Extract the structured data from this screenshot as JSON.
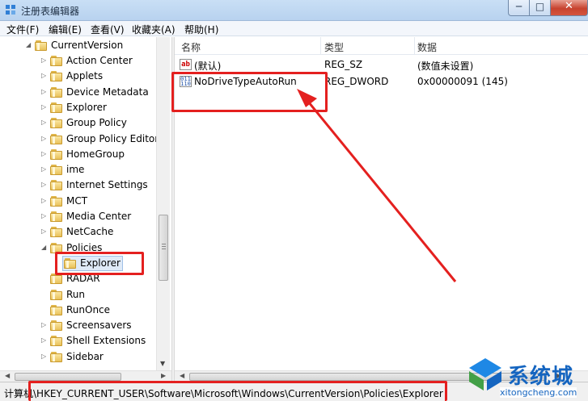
{
  "window": {
    "title": "注册表编辑器",
    "controls": {
      "minimize": "─",
      "maximize": "□",
      "close": "✕"
    }
  },
  "menu": [
    "文件(F)",
    "编辑(E)",
    "查看(V)",
    "收藏夹(A)",
    "帮助(H)"
  ],
  "tree": {
    "root": "CurrentVersion",
    "items": [
      "Action Center",
      "Applets",
      "Device Metadata",
      "Explorer",
      "Group Policy",
      "Group Policy Editor",
      "HomeGroup",
      "ime",
      "Internet Settings",
      "MCT",
      "Media Center",
      "NetCache",
      "Policies",
      "Explorer",
      "RADAR",
      "Run",
      "RunOnce",
      "Screensavers",
      "Shell Extensions",
      "Sidebar"
    ],
    "selected": "Explorer"
  },
  "list": {
    "columns": [
      "名称",
      "类型",
      "数据"
    ],
    "rows": [
      {
        "icon": "ab",
        "name": "(默认)",
        "type": "REG_SZ",
        "data": "(数值未设置)"
      },
      {
        "icon": "011 110",
        "name": "NoDriveTypeAutoRun",
        "type": "REG_DWORD",
        "data": "0x00000091 (145)"
      }
    ]
  },
  "status": {
    "path": "计算机\\HKEY_CURRENT_USER\\Software\\Microsoft\\Windows\\CurrentVersion\\Policies\\Explorer"
  },
  "watermark": {
    "brand": "系统城",
    "url": "xitongcheng.com"
  },
  "colors": {
    "annotation": "#e4201f",
    "watermark": "#1565c0"
  }
}
